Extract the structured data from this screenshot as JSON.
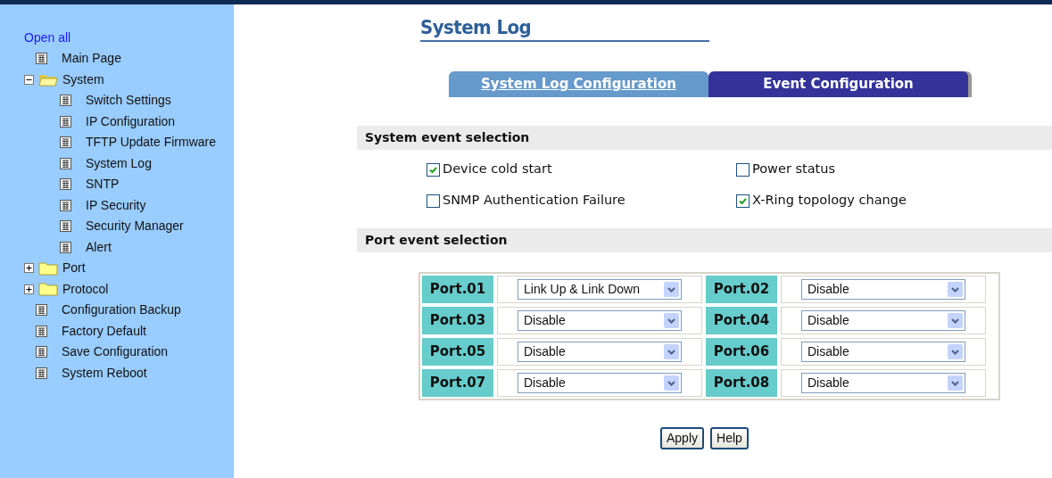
{
  "sidebar": {
    "open_all": "Open all",
    "items": [
      {
        "kind": "page",
        "label": "Main Page"
      },
      {
        "kind": "folder",
        "label": "System",
        "expanded": true,
        "children": [
          {
            "kind": "page",
            "label": "Switch Settings"
          },
          {
            "kind": "page",
            "label": "IP Configuration"
          },
          {
            "kind": "page",
            "label": "TFTP Update Firmware"
          },
          {
            "kind": "page",
            "label": "System Log"
          },
          {
            "kind": "page",
            "label": "SNTP"
          },
          {
            "kind": "page",
            "label": "IP Security"
          },
          {
            "kind": "page",
            "label": "Security Manager"
          },
          {
            "kind": "page",
            "label": "Alert"
          }
        ]
      },
      {
        "kind": "folder",
        "label": "Port",
        "expanded": false
      },
      {
        "kind": "folder",
        "label": "Protocol",
        "expanded": false
      },
      {
        "kind": "page",
        "label": "Configuration Backup"
      },
      {
        "kind": "page",
        "label": "Factory Default"
      },
      {
        "kind": "page",
        "label": "Save Configuration"
      },
      {
        "kind": "page",
        "label": "System Reboot"
      }
    ]
  },
  "page_title": "System Log",
  "tabs": [
    {
      "label": "System Log Configuration",
      "selected": false
    },
    {
      "label": "Event Configuration",
      "selected": true
    }
  ],
  "system_events": {
    "heading": "System event selection",
    "options": [
      {
        "label": "Device cold start",
        "checked": true
      },
      {
        "label": "Power status",
        "checked": false
      },
      {
        "label": "SNMP Authentication Failure",
        "checked": false
      },
      {
        "label": "X-Ring topology change",
        "checked": true
      }
    ]
  },
  "port_events": {
    "heading": "Port event selection",
    "ports": [
      {
        "label": "Port.01",
        "value": "Link Up & Link Down"
      },
      {
        "label": "Port.02",
        "value": "Disable"
      },
      {
        "label": "Port.03",
        "value": "Disable"
      },
      {
        "label": "Port.04",
        "value": "Disable"
      },
      {
        "label": "Port.05",
        "value": "Disable"
      },
      {
        "label": "Port.06",
        "value": "Disable"
      },
      {
        "label": "Port.07",
        "value": "Disable"
      },
      {
        "label": "Port.08",
        "value": "Disable"
      }
    ]
  },
  "buttons": [
    "Apply",
    "Help"
  ]
}
